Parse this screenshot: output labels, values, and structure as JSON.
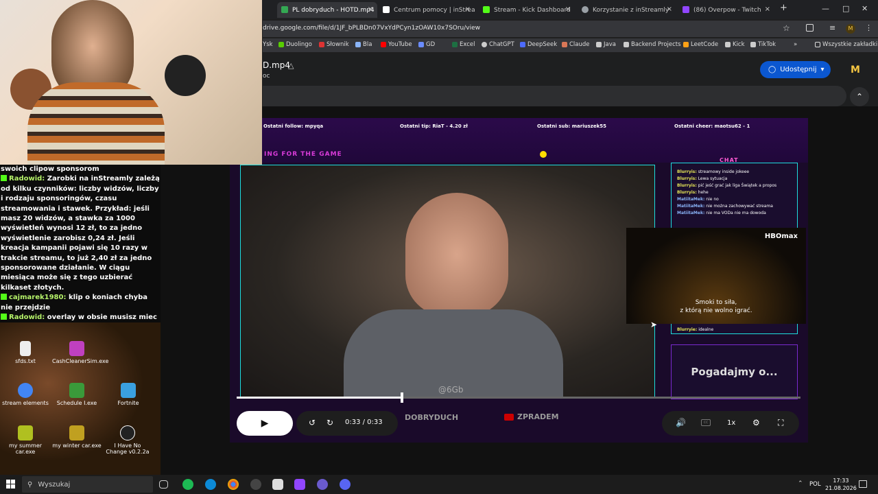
{
  "browser": {
    "tabs": [
      {
        "title": "PL dobryduch - HOTD.mp4",
        "color": "#34a853"
      },
      {
        "title": "Centrum pomocy | inStream",
        "color": "#ffffff"
      },
      {
        "title": "Stream - Kick Dashboard",
        "color": "#53fc18"
      },
      {
        "title": "Korzystanie z inStreamly",
        "color": "#9aa0a6"
      },
      {
        "title": "(86) Overpow - Twitch",
        "color": "#9146ff"
      }
    ],
    "new_tab": "+",
    "close": "×",
    "url": "drive.google.com/file/d/1JF_bPLBDn07VxYdPCyn1zOAW10x7SOru/view",
    "bookmarks": [
      {
        "label": "Ysk",
        "color": "#888"
      },
      {
        "label": "Duolingo",
        "color": "#58cc02"
      },
      {
        "label": "Słownik",
        "color": "#d33"
      },
      {
        "label": "Bla",
        "color": "#8ab4f8"
      },
      {
        "label": "YouTube",
        "color": "#ff0000"
      },
      {
        "label": "GD",
        "color": "#6a8cff"
      },
      {
        "label": "Excel",
        "color": "#1d6f42"
      },
      {
        "label": "ChatGPT",
        "color": "#ccc"
      },
      {
        "label": "DeepSeek",
        "color": "#4d6bfe"
      },
      {
        "label": "Claude",
        "color": "#d97757"
      },
      {
        "label": "Java",
        "color": "#ccc"
      },
      {
        "label": "Backend Projects",
        "color": "#ccc"
      },
      {
        "label": "LeetCode",
        "color": "#ffa116"
      },
      {
        "label": "Kick",
        "color": "#ccc"
      },
      {
        "label": "TikTok",
        "color": "#ccc"
      }
    ],
    "all_bookmarks": "Wszystkie zakładki",
    "profile_letter": "M"
  },
  "drive": {
    "filename": "D.mp4",
    "subtitle": "oc",
    "share_label": "Udostępnij",
    "avatar_letter": "M"
  },
  "chat": [
    {
      "user": "",
      "text": "swoich clipow sponsorom"
    },
    {
      "user": "Radowid:",
      "text": "Zarobki na inStreamly zależą od kilku czynników: liczby widzów, liczby i rodzaju sponsoringów, czasu streamowania i stawek. Przykład: jeśli masz 20 widzów, a stawka za 1000 wyświetleń wynosi 12 zł, to za jedno wyświetlenie zarobisz 0,24 zł. Jeśli kreacja kampanii pojawi się 10 razy w trakcie streamu, to już 2,40 zł za jedno sponsorowane działanie. W ciągu miesiąca może się z tego uzbierać kilkaset złotych."
    },
    {
      "user": "cajmarek1980:",
      "text": "klip o koniach chyba nie przejdzie"
    },
    {
      "user": "Radowid:",
      "text": "overlay w obsie musisz miec"
    }
  ],
  "desktop_icons": [
    {
      "label": "sfds.txt",
      "color": "#eee"
    },
    {
      "label": "CashCleanerSim.exe",
      "color": "#c040c0"
    },
    {
      "label": "stream elements",
      "color": "#4285f4"
    },
    {
      "label": "Schedule I.exe",
      "color": "#3a9a3a"
    },
    {
      "label": "Fortnite",
      "color": "#3aa0e0"
    },
    {
      "label": "my summer car.exe",
      "color": "#b0c020"
    },
    {
      "label": "my winter car.exe",
      "color": "#c0a020"
    },
    {
      "label": "I Have No Change v0.2.2a",
      "color": "#222"
    }
  ],
  "stream_overlay": {
    "alerts": [
      "Ostatni follow: mpyqa",
      "Ostatni tip: RiaT - 4.20 zł",
      "Ostatni sub: mariuszek55",
      "Ostatni cheer: maotsu62 - 1"
    ],
    "scroll_text": "ING FOR THE GAME",
    "chat_title": "CHAT",
    "chat_lines": [
      {
        "user": "Blurryis:",
        "text": "streamowy inside jokeee"
      },
      {
        "user": "Blurryis:",
        "text": "Lewa sytuacja"
      },
      {
        "user": "Blurryis:",
        "text": "pić jeść grać jak liga Świątek a propos"
      },
      {
        "user": "Blurryis:",
        "text": "hehe"
      },
      {
        "user": "MatiitaMek:",
        "text": "nie no"
      },
      {
        "user": "MatiitaMek:",
        "text": "nie można zachowywać streama"
      },
      {
        "user": "MatiitaMek:",
        "text": "nie ma VODa nie ma dowoda"
      },
      {
        "user": "Blurryie:",
        "text": "idealne"
      }
    ],
    "hbo_logo": "HBOmax",
    "subtitle_line1": "Smoki to siła,",
    "subtitle_line2": "z którą nie wolno igrać.",
    "pogadajmy": "Pogadajmy o...",
    "social1": "DOBRYDUCH",
    "social2": "ZPRADEM",
    "watermark": "@6Gb"
  },
  "player": {
    "time": "0:33 / 0:33",
    "progress": 0.293,
    "speed": "1x"
  },
  "taskbar": {
    "search_placeholder": "Wyszukaj",
    "lang": "POL",
    "time": "17:33",
    "date": "21.08.2026"
  }
}
